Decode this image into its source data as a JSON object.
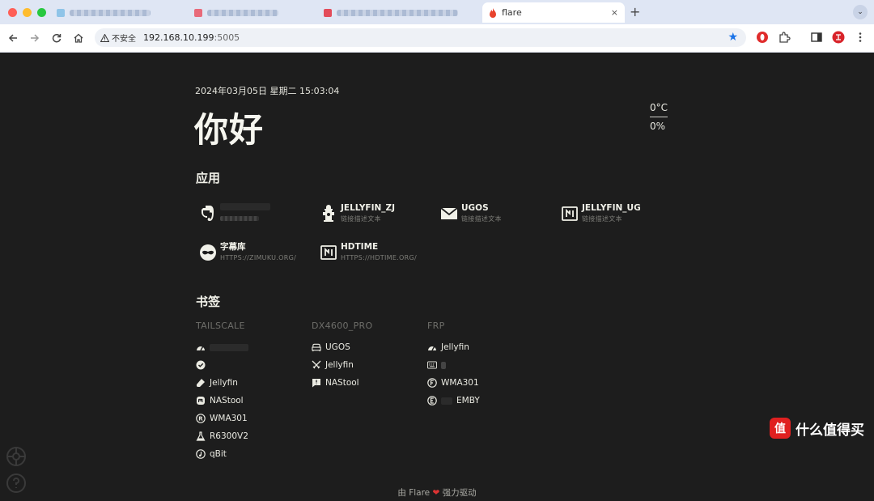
{
  "browser": {
    "active_tab_title": "flare",
    "security_label": "不安全",
    "url_host": "192.168.10.199",
    "url_port": ":5005",
    "close_glyph": "×",
    "new_tab_glyph": "+",
    "tab_menu_glyph": "⌄"
  },
  "page": {
    "datetime": "2024年03月05日 星期二 15:03:04",
    "greeting": "你好",
    "weather": {
      "temperature": "0°C",
      "humidity": "0%"
    },
    "apps_title": "应用",
    "apps": [
      {
        "name": "",
        "desc": "",
        "icon": "evernote-icon"
      },
      {
        "name": "JELLYFIN_ZJ",
        "desc": "链接描述文本",
        "icon": "fire-hydrant-icon"
      },
      {
        "name": "UGOS",
        "desc": "链接描述文本",
        "icon": "mail-icon"
      },
      {
        "name": "JELLYFIN_UG",
        "desc": "链接描述文本",
        "icon": "nfc-icon"
      },
      {
        "name": "字幕库",
        "desc": "HTTPS://ZIMUKU.ORG/",
        "icon": "domino-mask-icon"
      },
      {
        "name": "HDTIME",
        "desc": "HTTPS://HDTIME.ORG/",
        "icon": "nfc-icon"
      }
    ],
    "bookmarks_title": "书签",
    "bookmark_groups": [
      {
        "title": "TAILSCALE",
        "items": [
          {
            "label": "",
            "icon": "speedometer-icon"
          },
          {
            "label": "",
            "icon": "check-badge-icon"
          },
          {
            "label": "Jellyfin",
            "icon": "eraser-icon"
          },
          {
            "label": "NAStool",
            "icon": "mastodon-icon"
          },
          {
            "label": "WMA301",
            "icon": "registered-icon"
          },
          {
            "label": "R6300V2",
            "icon": "flask-icon"
          },
          {
            "label": "qBit",
            "icon": "music-note-icon"
          }
        ]
      },
      {
        "title": "DX4600_PRO",
        "items": [
          {
            "label": "UGOS",
            "icon": "sofa-icon"
          },
          {
            "label": "Jellyfin",
            "icon": "swords-icon"
          },
          {
            "label": "NAStool",
            "icon": "message-alert-icon"
          }
        ]
      },
      {
        "title": "FRP",
        "items": [
          {
            "label": "Jellyfin",
            "icon": "speedometer-icon"
          },
          {
            "label": "",
            "icon": "keyboard-icon"
          },
          {
            "label": "WMA301",
            "icon": "letter-f-circle-icon"
          },
          {
            "label": "EMBY",
            "icon": "letter-e-circle-icon"
          }
        ]
      }
    ],
    "footer": {
      "prefix": "由 Flare",
      "heart": "❤",
      "suffix": "强力驱动"
    }
  },
  "watermark": {
    "text": "什么值得买",
    "logo_char": "值"
  },
  "colors": {
    "page_bg": "#1d1d1d",
    "tabbar_bg": "#dfe6f4",
    "accent_blue": "#1a73e8",
    "heart": "#dd3333"
  }
}
